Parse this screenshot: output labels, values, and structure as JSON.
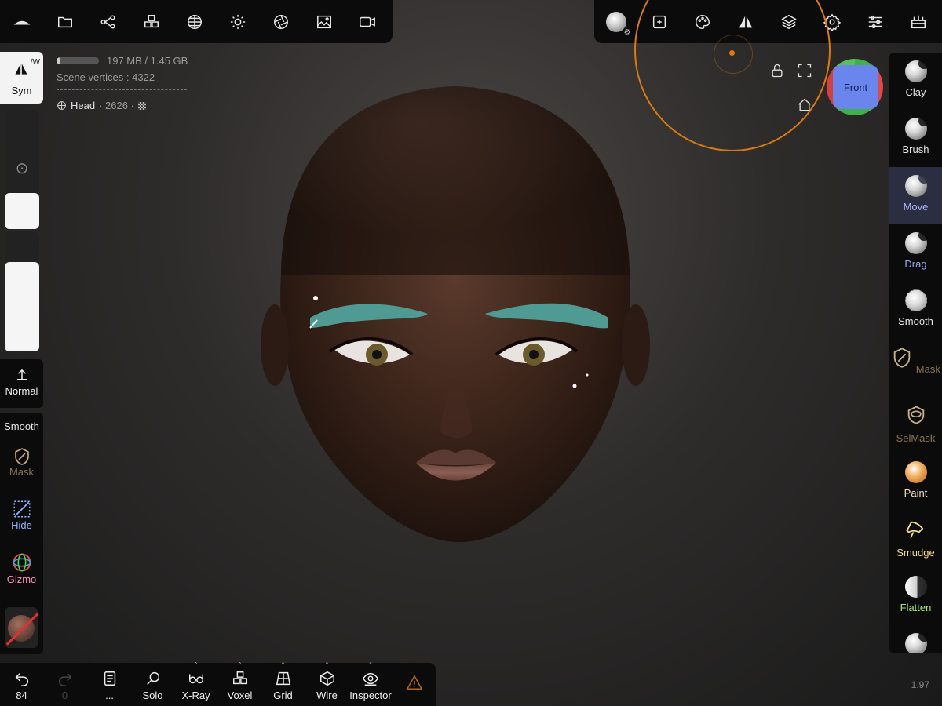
{
  "top_left_toolbar": [
    "sculpt-logo",
    "folder",
    "scene-graph",
    "topology",
    "wireframe-sphere",
    "light",
    "camera-aperture",
    "image",
    "video"
  ],
  "top_right_toolbar": [
    "material",
    "postprocess",
    "palette",
    "symmetry",
    "layers",
    "settings",
    "sliders",
    "interface"
  ],
  "info": {
    "memory": "197 MB / 1.45 GB",
    "memory_fraction": 0.08,
    "vertices_label": "Scene vertices :",
    "vertices_value": "4322",
    "object_name": "Head",
    "object_vertices": "· 2626 ·"
  },
  "left_panel": {
    "sym_label": "Sym",
    "sym_badge": "L/W",
    "radius_fraction": 0.3,
    "intensity_fraction": 0.75,
    "stroke_label": "Normal",
    "tools": [
      {
        "label": "Smooth",
        "color": "#e8e8e8"
      },
      {
        "label": "Mask",
        "color": "#8a7357"
      },
      {
        "label": "Hide",
        "color": "#8fb3ff"
      },
      {
        "label": "Gizmo",
        "color": "#ff8fb0"
      }
    ]
  },
  "view": {
    "cube_face": "Front",
    "accent_color": "#d97a10"
  },
  "right_tools": [
    {
      "label": "Clay",
      "color": "#e6e6e6",
      "active": false
    },
    {
      "label": "Brush",
      "color": "#e6e6e6",
      "active": false
    },
    {
      "label": "Move",
      "color": "#a8b6ff",
      "active": true
    },
    {
      "label": "Drag",
      "color": "#9eaaf0",
      "active": false
    },
    {
      "label": "Smooth",
      "color": "#e6e6e6",
      "active": false
    },
    {
      "label": "Mask",
      "color": "#8a7357",
      "active": false
    },
    {
      "label": "SelMask",
      "color": "#8a7357",
      "active": false
    },
    {
      "label": "Paint",
      "color": "#f0e1c0",
      "active": false
    },
    {
      "label": "Smudge",
      "color": "#f3dc8a",
      "active": false
    },
    {
      "label": "Flatten",
      "color": "#a6e36a",
      "active": false
    }
  ],
  "bottom_bar": {
    "undo_count": "84",
    "redo_count": "0",
    "more_label": "...",
    "items": [
      "Solo",
      "X-Ray",
      "Voxel",
      "Grid",
      "Wire",
      "Inspector"
    ]
  },
  "version": "1.97"
}
